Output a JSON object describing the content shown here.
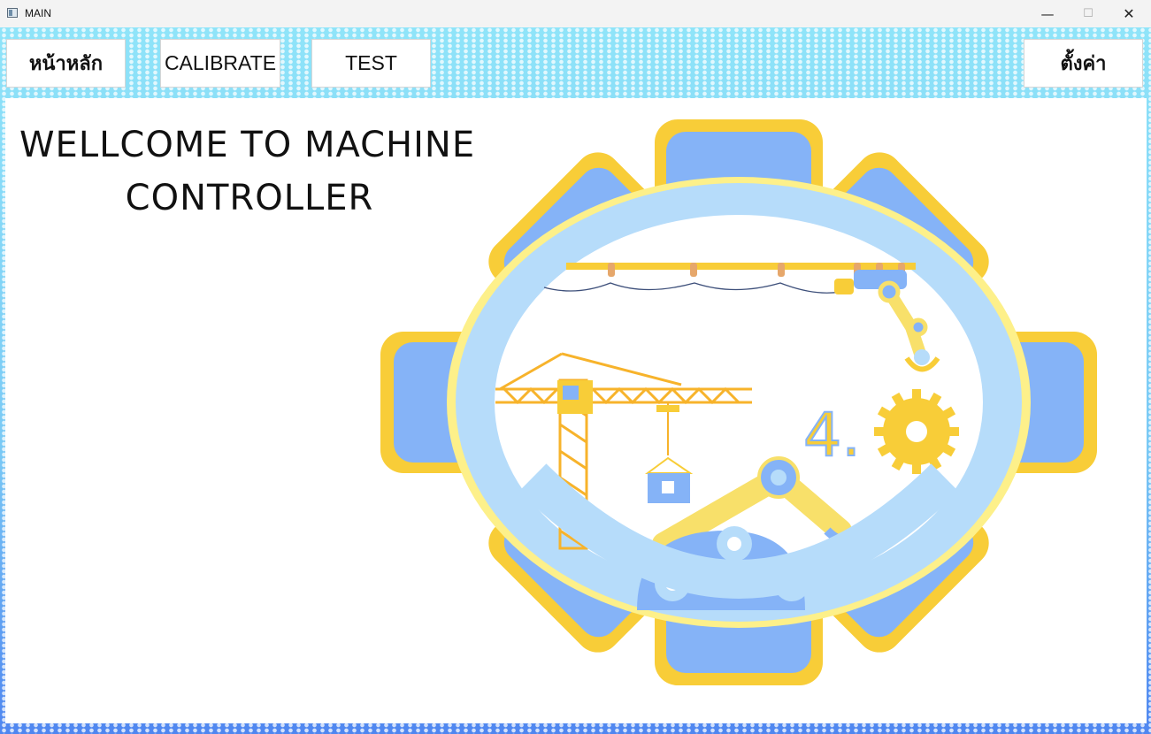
{
  "window": {
    "title": "MAIN",
    "min_symbol": "—",
    "max_symbol": "☐",
    "close_symbol": "✕"
  },
  "nav": {
    "home_label": "หน้าหลัก",
    "calibrate_label": "CALIBRATE",
    "test_label": "TEST",
    "settings_label": "ตั้งค่า"
  },
  "main": {
    "welcome_line1": "WELLCOME TO MACHINE",
    "welcome_line2": "CONTROLLER",
    "illustration": {
      "badge_text": "4.",
      "icon": "industry-4-gear-illustration"
    }
  },
  "colors": {
    "gear_blue": "#85b3f7",
    "gear_yellow": "#f8cd38",
    "ring_blue": "#b6dcfa",
    "crane_yellow": "#f7b32b"
  }
}
